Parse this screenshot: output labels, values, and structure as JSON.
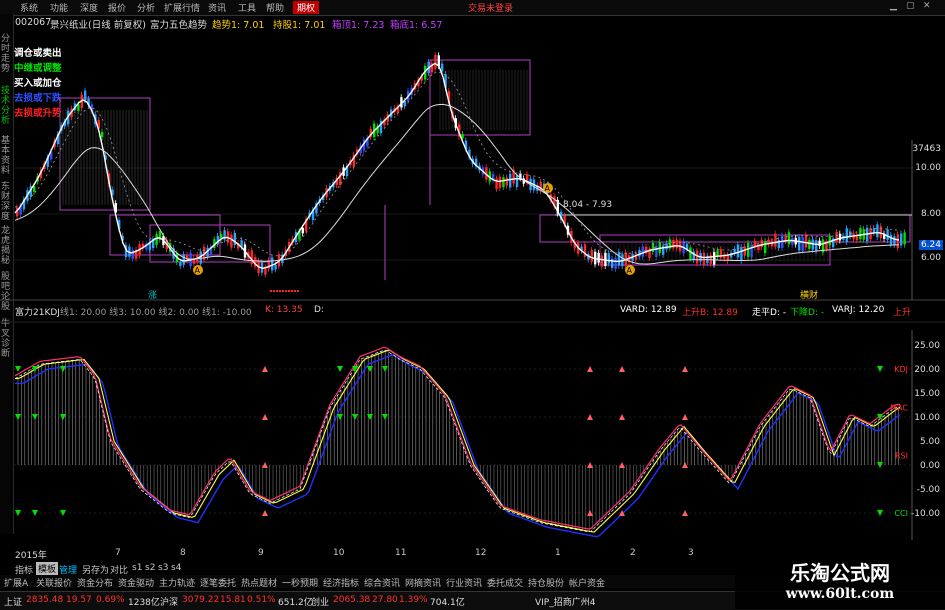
{
  "menu": {
    "items": [
      "系统",
      "功能",
      "深度",
      "报价",
      "分析",
      "扩展行情",
      "资讯",
      "工具",
      "帮助"
    ],
    "active": "期权",
    "right": [
      "交易未登录"
    ]
  },
  "title": {
    "code": "002067",
    "name": "景兴纸业(日线 前复权)",
    "indicator": "富力五色趋势",
    "trend_label": "趋势1: 7.01",
    "support_label": "持股1: 7.01",
    "top_label": "箱顶1: 7.23",
    "bottom_label": "箱底1: 6.57"
  },
  "legend": [
    {
      "text": "调仓或卖出",
      "color": "#ffffff"
    },
    {
      "text": "中继或调整",
      "color": "#00e000"
    },
    {
      "text": "买入或加仓",
      "color": "#ffffff"
    },
    {
      "text": "去损或下跌",
      "color": "#3050ff"
    },
    {
      "text": "去损或升势",
      "color": "#ff2020"
    }
  ],
  "sidebar": {
    "tabs": [
      "分时走势",
      "技术分析",
      "基本资料",
      "东财深度",
      "龙虎揭秘",
      "股吧论股",
      "牛叉诊断"
    ]
  },
  "price_axis": {
    "top_value": "37463",
    "labels": [
      "10.00",
      "8.00",
      "6.00"
    ],
    "current": "6.24"
  },
  "annotations": {
    "range_text": "8.04 - 7.93",
    "mid_marker": "涨",
    "right_marker": "横财"
  },
  "sub_indicator": {
    "name": "富力21KDJ",
    "params": "线1: 20.00 线3: 10.00 线2: 0.00 线1: -10.00",
    "k_label": "K: 13.35",
    "d_label": "D:",
    "vard": "VARD: 12.89",
    "up1": "上升B: 12.89",
    "pingd": "走平D: -",
    "down": "下降D: -",
    "varj": "VARJ: 12.20",
    "up2": "上升"
  },
  "sub_axis": {
    "labels": [
      "25.00",
      "20.00",
      "15.00",
      "10.00",
      "5.00",
      "0.00",
      "-5.00",
      "-10.00"
    ],
    "tags": [
      "KDJ",
      "MAC",
      "RSI",
      "CCI"
    ]
  },
  "date_axis": {
    "year": "2015年",
    "months": [
      "7",
      "8",
      "9",
      "10",
      "11",
      "12",
      "1",
      "2",
      "3"
    ]
  },
  "function_tabs": [
    "指标",
    "模板",
    "管理",
    "另存为",
    "对比",
    "s1",
    "s2",
    "s3",
    "s4"
  ],
  "bottom_tabs": [
    "扩展A",
    "关联报价",
    "资金分布",
    "资金驱动",
    "主力轨迹",
    "逐笔委托",
    "热点题材",
    "一秒预期",
    "经济指标",
    "综合资讯",
    "网摘资讯",
    "行业资讯",
    "委托成交",
    "持仓股份",
    "帐户资金"
  ],
  "status": {
    "sh_label": "上证",
    "sh_value": "2835.48",
    "sh_change": "19.57",
    "sh_pct": "0.69%",
    "sh_amount": "1238亿",
    "sz_label": "沪深",
    "sz_value": "3079.22",
    "sz_change": "15.81",
    "sz_pct": "0.51%",
    "sz_amount": "651.2亿",
    "cy_label": "创业",
    "cy_value": "2065.38",
    "cy_change": "27.80",
    "cy_pct": "1.39%",
    "cy_amount": "704.1亿",
    "server": "VIP_招商广州4"
  },
  "watermark": {
    "title": "乐淘公式网",
    "url": "www.60lt.com"
  },
  "colors": {
    "up": "#ff2020",
    "down": "#00c0ff",
    "green": "#00e000",
    "magenta": "#c040ff",
    "yellow": "#ffd000",
    "active_menu": "#c00000"
  }
}
